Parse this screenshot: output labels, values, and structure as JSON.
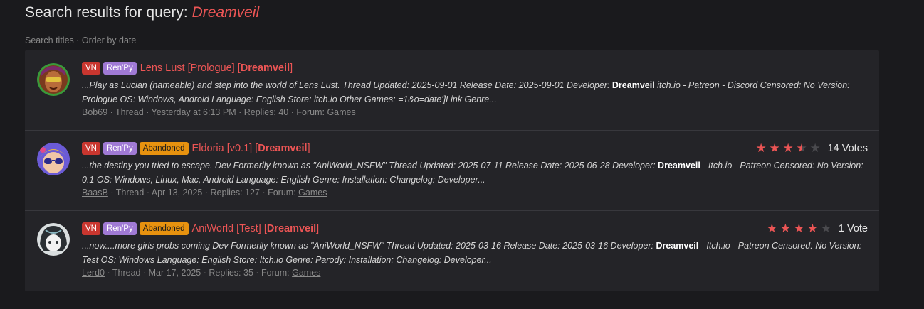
{
  "header": {
    "title_prefix": "Search results for query:",
    "query": "Dreamveil"
  },
  "subnav": {
    "search_titles": "Search titles",
    "separator": " · ",
    "order_by_date": "Order by date"
  },
  "results": [
    {
      "tags": [
        "VN",
        "Ren'Py"
      ],
      "title": "Lens Lust [Prologue] [",
      "title_highlight": "Dreamveil",
      "title_suffix": "]",
      "snippet_before": "...Play as Lucian (nameable) and step into the world of Lens Lust. Thread Updated: 2025-09-01 Release Date: 2025-09-01 Developer: ",
      "snippet_highlight": "Dreamveil",
      "snippet_after": " itch.io - Patreon - Discord Censored: No Version: Prologue OS: Windows, Android Language: English Store: itch.io Other Games: =1&o=date']Link Genre...",
      "author": "Bob69",
      "type": "Thread",
      "date": "Yesterday at 6:13 PM",
      "replies": "Replies: 40",
      "forum_label": "Forum:",
      "forum": "Games",
      "rating": null
    },
    {
      "tags": [
        "VN",
        "Ren'Py",
        "Abandoned"
      ],
      "title": "Eldoria [v0.1] [",
      "title_highlight": "Dreamveil",
      "title_suffix": "]",
      "snippet_before": "...the destiny you tried to escape. Dev Formerlly known as \"AniWorld_NSFW\" Thread Updated: 2025-07-11 Release Date: 2025-06-28 Developer: ",
      "snippet_highlight": "Dreamveil",
      "snippet_after": " - Itch.io - Patreon Censored: No Version: 0.1 OS: Windows, Linux, Mac, Android Language: English Genre: Installation: Changelog: Developer...",
      "author": "BaasB",
      "type": "Thread",
      "date": "Apr 13, 2025",
      "replies": "Replies: 127",
      "forum_label": "Forum:",
      "forum": "Games",
      "rating": {
        "stars": 3.5,
        "votes": "14 Votes"
      }
    },
    {
      "tags": [
        "VN",
        "Ren'Py",
        "Abandoned"
      ],
      "title": "AniWorld [Test] [",
      "title_highlight": "Dreamveil",
      "title_suffix": "]",
      "snippet_before": "...now....more girls probs coming Dev Formerlly known as \"AniWorld_NSFW\" Thread Updated: 2025-03-16 Release Date: 2025-03-16 Developer: ",
      "snippet_highlight": "Dreamveil",
      "snippet_after": " - Itch.io - Patreon Censored: No Version: Test OS: Windows Language: English Store: Itch.io Genre: Parody: Installation: Changelog: Developer...",
      "author": "Lerd0",
      "type": "Thread",
      "date": "Mar 17, 2025",
      "replies": "Replies: 35",
      "forum_label": "Forum:",
      "forum": "Games",
      "rating": {
        "stars": 4,
        "votes": "1 Vote"
      }
    }
  ],
  "colors": {
    "accent": "#ec5555",
    "tag_vn": "#c9362f",
    "tag_renpy": "#a07ad5",
    "tag_abandoned": "#e7920f"
  }
}
